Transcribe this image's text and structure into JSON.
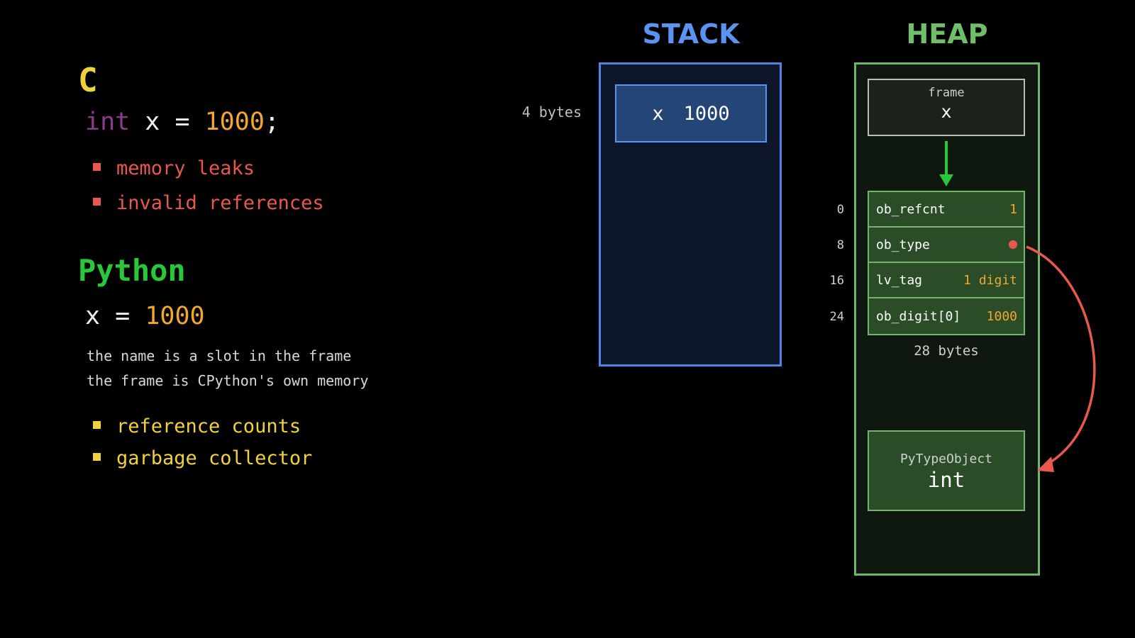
{
  "c_section": {
    "heading": "C",
    "code": {
      "keyword": "int",
      "name": "x",
      "op": "=",
      "value": "1000",
      "end": ";"
    },
    "bullets": [
      "memory leaks",
      "invalid references"
    ]
  },
  "python_section": {
    "heading": "Python",
    "code": {
      "name": "x",
      "op": "=",
      "value": "1000"
    },
    "notes": [
      "the name is a slot in the frame",
      "the frame is CPython's own memory"
    ],
    "bullets": [
      "reference counts",
      "garbage collector"
    ]
  },
  "stack": {
    "title": "STACK",
    "size_label": "4 bytes",
    "slot": {
      "name": "x",
      "value": "1000"
    }
  },
  "heap": {
    "title": "HEAP",
    "frame": {
      "label": "frame",
      "var": "x"
    },
    "object": {
      "fields": [
        {
          "offset": "0",
          "name": "ob_refcnt",
          "value": "1"
        },
        {
          "offset": "8",
          "name": "ob_type",
          "value": ""
        },
        {
          "offset": "16",
          "name": "lv_tag",
          "value": "1 digit"
        },
        {
          "offset": "24",
          "name": "ob_digit[0]",
          "value": "1000"
        }
      ],
      "size_label": "28 bytes"
    },
    "type_object": {
      "label": "PyTypeObject",
      "name": "int"
    }
  },
  "colors": {
    "stack_accent": "#4f84e6",
    "heap_accent": "#6fb56a",
    "warning": "#e8584d",
    "highlight": "#f0d23c",
    "pointer_arrow": "#27c83a",
    "type_arrow": "#e8584d"
  }
}
